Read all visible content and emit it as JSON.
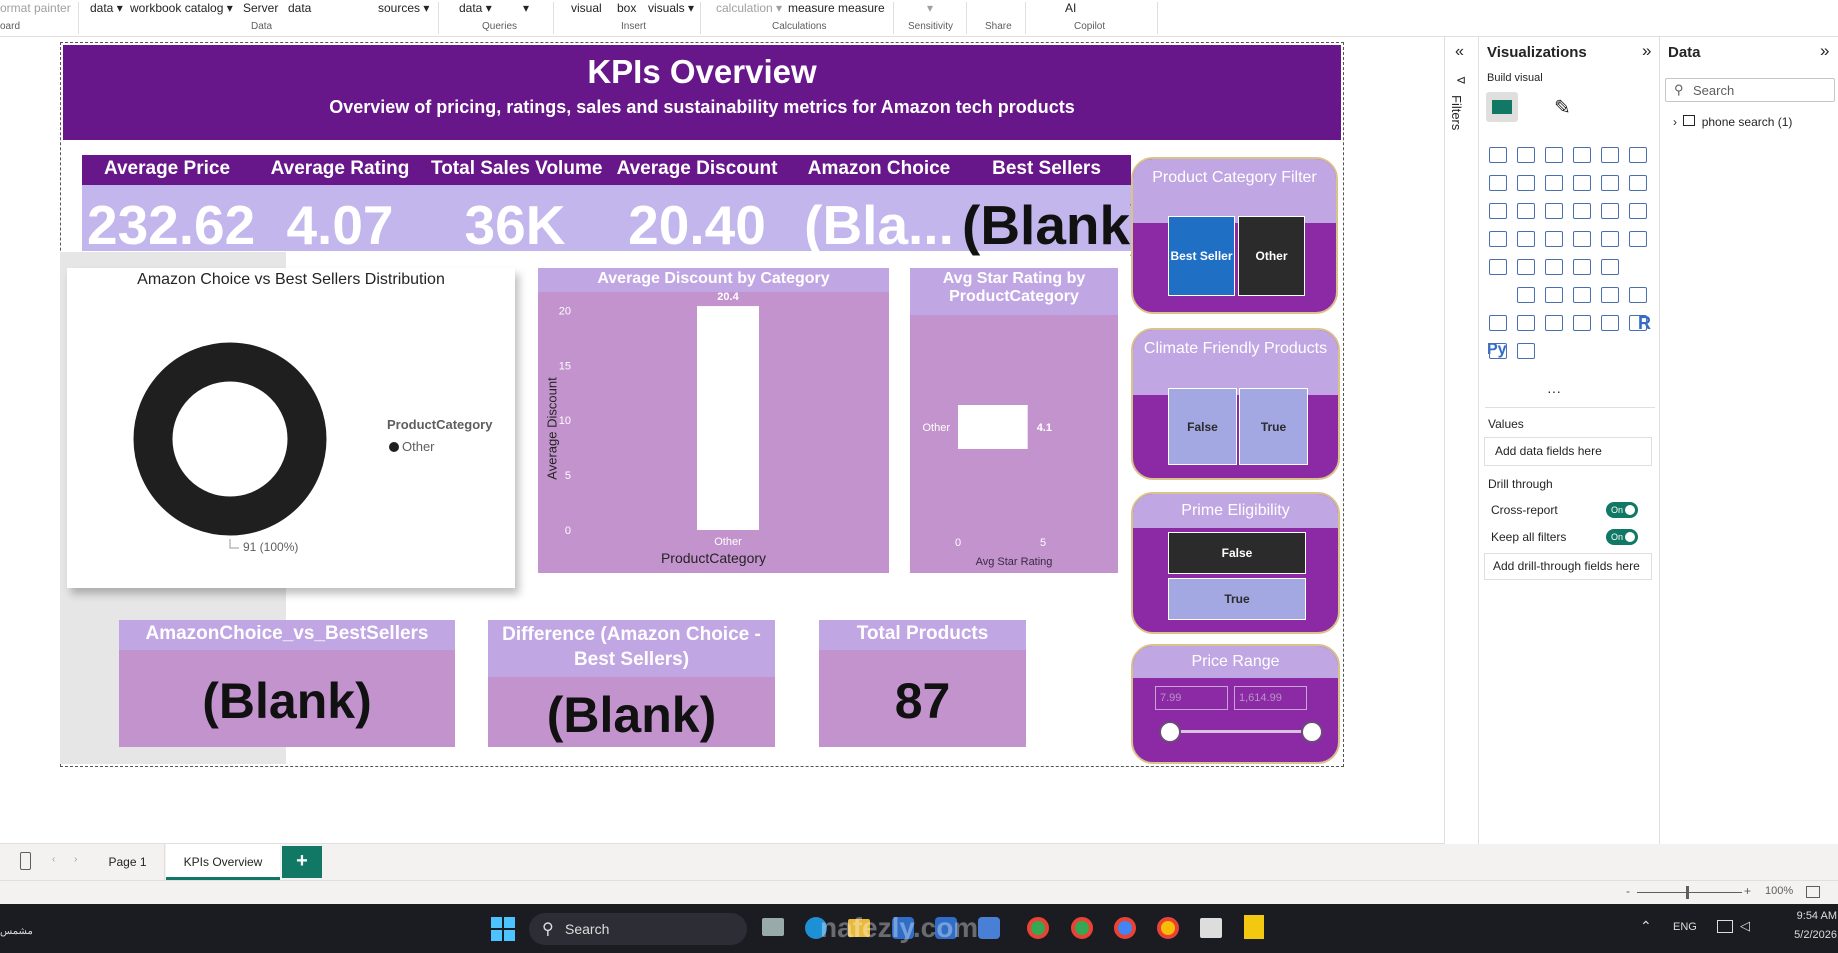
{
  "ribbon": {
    "items": [
      "ormat painter",
      "data",
      "workbook catalog",
      "Server",
      "data",
      "sources",
      "data",
      "visual",
      "box",
      "visuals",
      "calculation",
      "measure measure",
      "AI"
    ],
    "groups": [
      "oard",
      "Data",
      "Queries",
      "Insert",
      "Calculations",
      "Sensitivity",
      "Share",
      "Copilot"
    ]
  },
  "header": {
    "title": "KPIs Overview",
    "subtitle": "Overview of pricing, ratings, sales and sustainability metrics for Amazon tech products"
  },
  "kpis": [
    {
      "label": "Average Price",
      "value": "232.62"
    },
    {
      "label": "Average Rating",
      "value": "4.07"
    },
    {
      "label": "Total Sales Volume",
      "value": "36K"
    },
    {
      "label": "Average Discount",
      "value": "20.40"
    },
    {
      "label": "Amazon Choice",
      "value": "(Bla..."
    },
    {
      "label": "Best Sellers",
      "value": "(Blank)"
    }
  ],
  "donut": {
    "title": "Amazon Choice vs Best Sellers Distribution",
    "legend_title": "ProductCategory",
    "legend_item": "Other",
    "data_label": "91 (100%)",
    "color": "#1f1f1f"
  },
  "bottom_cards": [
    {
      "label": "AmazonChoice_vs_BestSellers",
      "value": "(Blank)"
    },
    {
      "label": "Difference (Amazon Choice - Best Sellers)",
      "value": "(Blank)"
    },
    {
      "label": "Total Products",
      "value": "87"
    }
  ],
  "chart_data": [
    {
      "type": "bar",
      "title": "Average Discount by Category",
      "categories": [
        "Other"
      ],
      "values": [
        20.4
      ],
      "data_labels": [
        "20.4"
      ],
      "xlabel": "ProductCategory",
      "ylabel": "Average Discount",
      "yticks": [
        "0",
        "5",
        "10",
        "15",
        "20"
      ],
      "ylim": [
        0,
        21.5
      ]
    },
    {
      "type": "bar",
      "orientation": "horizontal",
      "title": "Avg Star Rating by ProductCategory",
      "categories": [
        "Other"
      ],
      "values": [
        4.1
      ],
      "data_labels": [
        "4.1"
      ],
      "xlabel": "Avg Star Rating",
      "xticks": [
        "0",
        "5"
      ],
      "xlim": [
        0,
        5
      ]
    }
  ],
  "slicers": {
    "category": {
      "title": "Product Category Filter",
      "options": [
        "Best Seller",
        "Other"
      ]
    },
    "climate": {
      "title": "Climate Friendly Products",
      "options": [
        "False",
        "True"
      ]
    },
    "prime": {
      "title": "Prime Eligibility",
      "options": [
        "False",
        "True"
      ]
    },
    "price": {
      "title": "Price Range",
      "min": "7.99",
      "max": "1,614.99"
    }
  },
  "pages": {
    "tabs": [
      "Page 1",
      "KPIs Overview"
    ],
    "active": "KPIs Overview",
    "add": "+"
  },
  "filters_label": "Filters",
  "viz_pane": {
    "title": "Visualizations",
    "build": "Build visual",
    "values_label": "Values",
    "values_placeholder": "Add data fields here",
    "drill_label": "Drill through",
    "cross_report": "Cross-report",
    "keep_filters": "Keep all filters",
    "toggle_on": "On",
    "drill_placeholder": "Add drill-through fields here",
    "r_icon": "R",
    "py_icon": "Py",
    "more": "···"
  },
  "data_pane": {
    "title": "Data",
    "search_placeholder": "Search",
    "table": "phone search (1)"
  },
  "status": {
    "zoom": "100%",
    "minus": "-",
    "plus": "+"
  },
  "taskbar": {
    "search": "Search",
    "lang": "ENG",
    "time": "9:54 AM",
    "date": "5/2/2026",
    "left_text": "مشمس",
    "watermark": "nafezly.com"
  },
  "colors": {
    "header": "#68178b",
    "card": "#c293cd",
    "card_head": "#c1a6e4",
    "slicer_bg": "#8c2aa6",
    "btn_blue": "#1f6fc4",
    "btn_dark": "#2b2b2b",
    "btn_lav": "#a3a7e2"
  }
}
